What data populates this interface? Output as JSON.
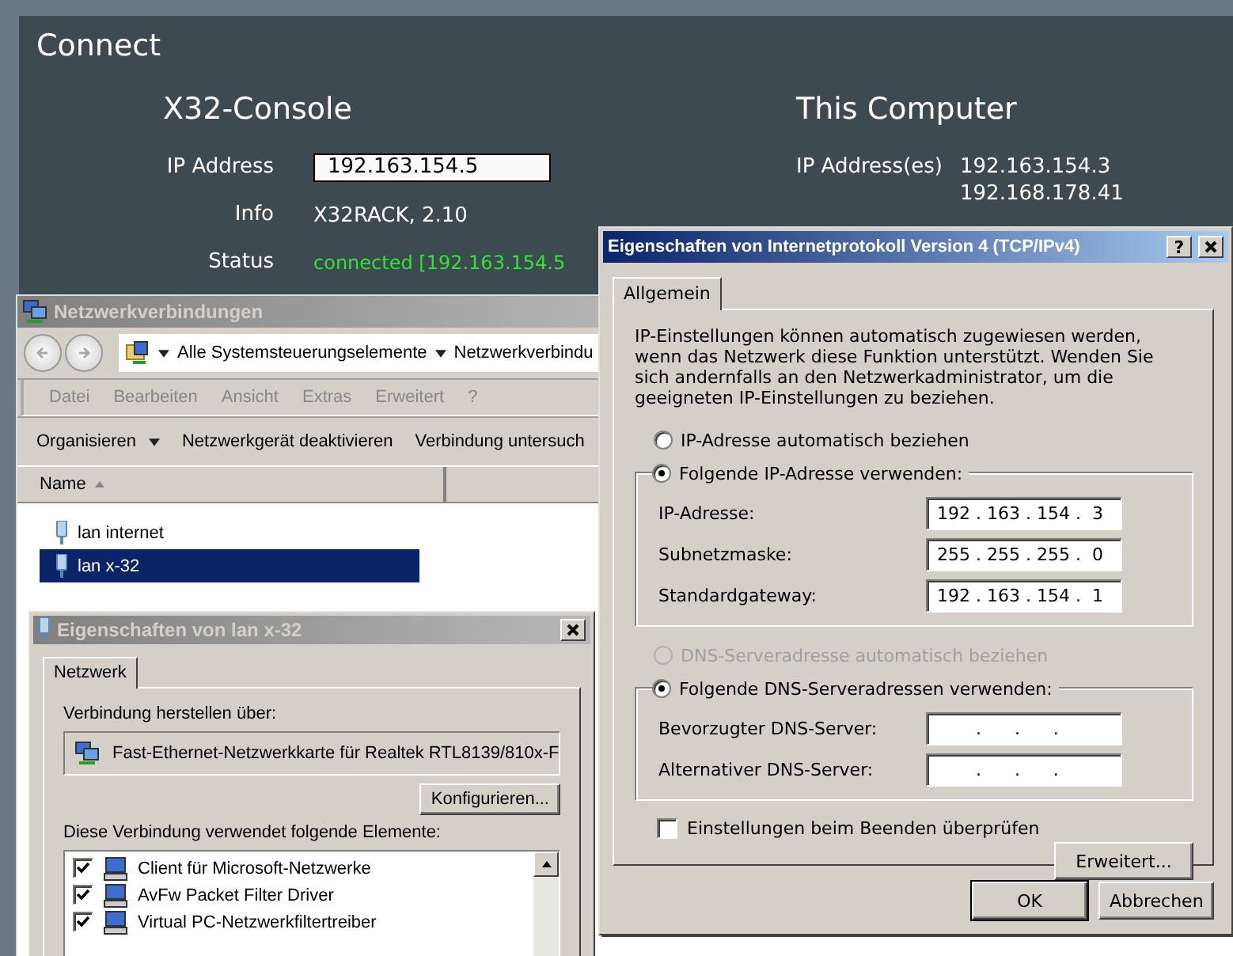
{
  "connect": {
    "title": "Connect",
    "console": {
      "heading": "X32-Console",
      "fields": [
        {
          "kind": "input",
          "label": "IP Address",
          "value": "192.163.154.5"
        },
        {
          "kind": "text",
          "label": "Info",
          "value": "X32RACK, 2.10"
        },
        {
          "kind": "status",
          "label": "Status",
          "value": "connected [192.163.154.5"
        }
      ]
    },
    "computer": {
      "heading": "This Computer",
      "label": "IP Address(es)",
      "addresses": [
        "192.163.154.3",
        "192.168.178.41"
      ]
    }
  },
  "explorer": {
    "title": "Netzwerkverbindungen",
    "breadcrumb": [
      "Alle Systemsteuerungselemente",
      "Netzwerkverbindu"
    ],
    "menu": [
      "Datei",
      "Bearbeiten",
      "Ansicht",
      "Extras",
      "Erweitert",
      "?"
    ],
    "toolbar": [
      {
        "label": "Organisieren",
        "dropdown": true
      },
      {
        "label": "Netzwerkgerät deaktivieren",
        "dropdown": false
      },
      {
        "label": "Verbindung untersuch",
        "dropdown": false
      }
    ],
    "column": "Name",
    "items": [
      {
        "label": "lan internet",
        "selected": false
      },
      {
        "label": "lan x-32",
        "selected": true
      }
    ]
  },
  "lan_dialog": {
    "title": "Eigenschaften von lan x-32",
    "tab": "Netzwerk",
    "connect_label": "Verbindung herstellen über:",
    "adapter": "Fast-Ethernet-Netzwerkkarte für Realtek RTL8139/810x-F",
    "configure_button": "Konfigurieren...",
    "elements_label": "Diese Verbindung verwendet folgende Elemente:",
    "elements": [
      {
        "label": "Client für Microsoft-Netzwerke",
        "checked": true
      },
      {
        "label": "AvFw Packet Filter Driver",
        "checked": true
      },
      {
        "label": "Virtual PC-Netzwerkfiltertreiber",
        "checked": true
      }
    ]
  },
  "ipv4_dialog": {
    "title": "Eigenschaften von Internetprotokoll Version 4 (TCP/IPv4)",
    "help": "?",
    "tab": "Allgemein",
    "description": "IP-Einstellungen können automatisch zugewiesen werden, wenn das Netzwerk diese Funktion unterstützt. Wenden Sie sich andernfalls an den Netzwerkadministrator, um die geeigneten IP-Einstellungen zu beziehen.",
    "ip_options": [
      {
        "label": "IP-Adresse automatisch beziehen",
        "selected": false,
        "disabled": false
      },
      {
        "label": "Folgende IP-Adresse verwenden:",
        "selected": true,
        "disabled": false
      }
    ],
    "ip_fields": [
      {
        "label": "IP-Adresse:",
        "value": "192 . 163 . 154 .  3"
      },
      {
        "label": "Subnetzmaske:",
        "value": "255 . 255 . 255 .  0"
      },
      {
        "label": "Standardgateway:",
        "value": "192 . 163 . 154 .  1"
      }
    ],
    "dns_options": [
      {
        "label": "DNS-Serveradresse automatisch beziehen",
        "selected": false,
        "disabled": true
      },
      {
        "label": "Folgende DNS-Serveradressen verwenden:",
        "selected": true,
        "disabled": false
      }
    ],
    "dns_fields": [
      {
        "label": "Bevorzugter DNS-Server:",
        "value": "       .      .      ."
      },
      {
        "label": "Alternativer DNS-Server:",
        "value": "       .      .      ."
      }
    ],
    "validate": {
      "label": "Einstellungen beim Beenden überprüfen",
      "checked": false
    },
    "advanced_button": "Erweitert...",
    "buttons": [
      {
        "label": "OK",
        "default": true
      },
      {
        "label": "Abbrechen",
        "default": false
      }
    ]
  }
}
